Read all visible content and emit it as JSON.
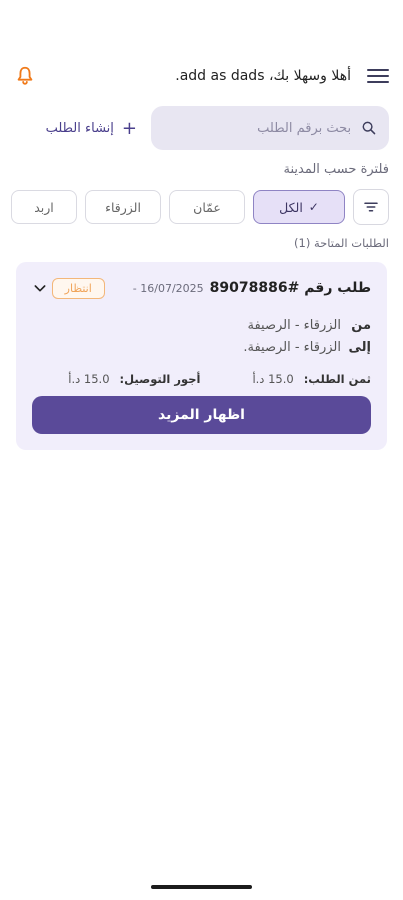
{
  "header": {
    "greeting": "أهلا وسهلا بك، add as dads.",
    "menu_icon": "menu-icon",
    "bell_icon": "bell-icon",
    "bell_color": "#f07a1a"
  },
  "search": {
    "placeholder": "بحث برقم الطلب",
    "icon": "search-icon"
  },
  "create_order": {
    "label": "إنشاء الطلب",
    "icon": "plus-icon"
  },
  "filter": {
    "title": "فلترة حسب المدينة",
    "icon": "filter-icon",
    "chips": [
      {
        "label": "الكل",
        "selected": true
      },
      {
        "label": "عمّان",
        "selected": false
      },
      {
        "label": "الزرقاء",
        "selected": false
      },
      {
        "label": "اربد",
        "selected": false
      }
    ]
  },
  "orders": {
    "available_label": "الطلبات المتاحة (1)",
    "items": [
      {
        "title": "طلب رقم #89078886",
        "date": "16/07/2025 -",
        "status": "انتظار",
        "from_label": "من",
        "from_value": "الزرقاء - الرصيفة",
        "to_label": "إلى",
        "to_value": "الزرقاء - الرصيفة.",
        "price_label": "ثمن الطلب:",
        "price_value": "15.0 د.أ",
        "fee_label": "أجور التوصيل:",
        "fee_value": "15.0 د.أ",
        "more_label": "اظهار المزيد"
      }
    ]
  },
  "colors": {
    "primary": "#5a4a99",
    "card_bg": "#f1eefb",
    "status": "#f0a45a"
  }
}
